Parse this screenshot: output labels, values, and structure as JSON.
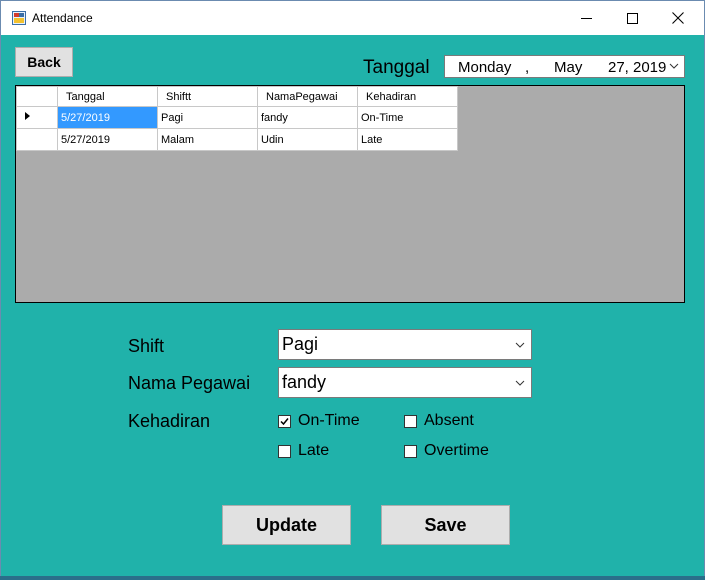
{
  "window": {
    "title": "Attendance"
  },
  "toolbar": {
    "back_label": "Back"
  },
  "date_filter": {
    "label": "Tanggal",
    "day": "Monday",
    "comma": ",",
    "month": "May",
    "date": "27,",
    "year": "2019"
  },
  "grid": {
    "columns": [
      "Tanggal",
      "Shiftt",
      "NamaPegawai",
      "Kehadiran"
    ],
    "rows": [
      {
        "tanggal": "5/27/2019",
        "shift": "Pagi",
        "nama": "fandy",
        "kehadiran": "On-Time"
      },
      {
        "tanggal": "5/27/2019",
        "shift": "Malam",
        "nama": "Udin",
        "kehadiran": "Late"
      }
    ]
  },
  "form": {
    "shift_label": "Shift",
    "shift_value": "Pagi",
    "nama_label": "Nama Pegawai",
    "nama_value": "fandy",
    "kehadiran_label": "Kehadiran",
    "options": [
      {
        "label": "On-Time",
        "checked": true
      },
      {
        "label": "Absent",
        "checked": false
      },
      {
        "label": "Late",
        "checked": false
      },
      {
        "label": "Overtime",
        "checked": false
      }
    ]
  },
  "actions": {
    "update_label": "Update",
    "save_label": "Save"
  },
  "colors": {
    "client_bg": "#20b2aa",
    "grid_bg": "#ababab",
    "selection": "#3399ff"
  }
}
